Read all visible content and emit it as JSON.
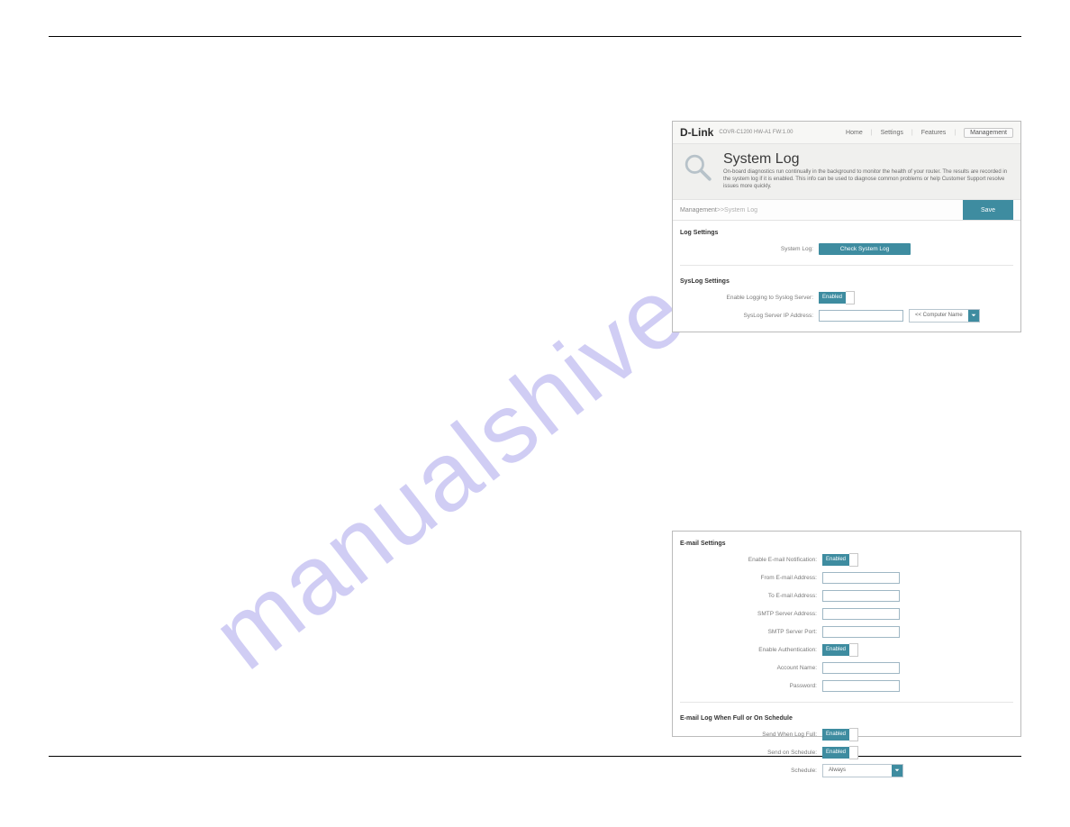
{
  "watermark": "manualshive.com",
  "panel1": {
    "brand": "D-Link",
    "subbrand": "COVR-C1200 HW-A1 FW:1.00",
    "nav": {
      "home": "Home",
      "settings": "Settings",
      "features": "Features",
      "management": "Management"
    },
    "title": "System Log",
    "desc": "On-board diagnostics run continually in the background to monitor the health of your router. The results are recorded in the system log if it is enabled. This info can be used to diagnose common problems or help Customer Support resolve issues more quickly.",
    "crumb1": "Management",
    "crumb_sep": " >> ",
    "crumb2": "System Log",
    "save": "Save",
    "log_settings_h": "Log Settings",
    "system_log_lbl": "System Log:",
    "check_btn": "Check System Log",
    "syslog_h": "SysLog Settings",
    "enable_log_lbl": "Enable Logging to Syslog Server:",
    "enabled": "Enabled",
    "ip_lbl": "SysLog Server IP Address:",
    "computer_name": "<< Computer Name"
  },
  "panel2": {
    "email_h": "E-mail Settings",
    "enable_email_lbl": "Enable E-mail Notification:",
    "enabled": "Enabled",
    "from_lbl": "From E-mail Address:",
    "to_lbl": "To E-mail Address:",
    "smtp_addr_lbl": "SMTP Server Address:",
    "smtp_port_lbl": "SMTP Server Port:",
    "enable_auth_lbl": "Enable Authentication:",
    "acct_lbl": "Account Name:",
    "pwd_lbl": "Password:",
    "sched_h": "E-mail Log When Full or On Schedule",
    "send_full_lbl": "Send When Log Full:",
    "send_sched_lbl": "Send on Schedule:",
    "schedule_lbl": "Schedule:",
    "always": "Always"
  }
}
